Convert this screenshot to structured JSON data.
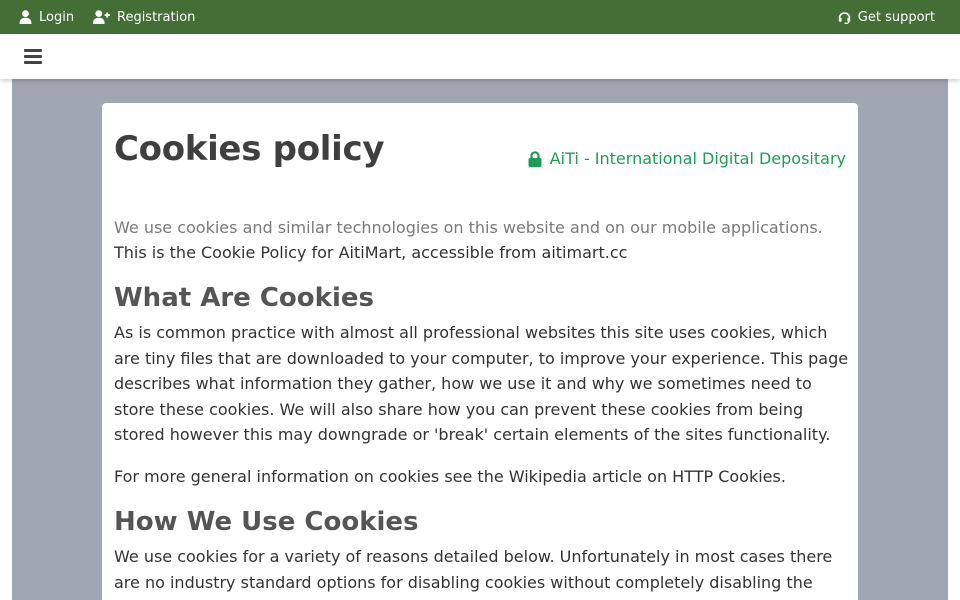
{
  "topbar": {
    "login_label": "Login",
    "registration_label": "Registration",
    "support_label": "Get support",
    "background_color": "#436f36"
  },
  "navbar": {
    "menu_icon": "hamburger-menu-icon"
  },
  "card": {
    "title": "Cookies policy",
    "brand_label": "AiTi - International Digital Depositary",
    "brand_color": "#1f9d56",
    "intro_line1": "We use cookies and similar technologies on this website and on our mobile applications.",
    "intro_line2": "This is the Cookie Policy for AitiMart, accessible from aitimart.cc",
    "sections": [
      {
        "heading": "What Are Cookies",
        "paragraphs": [
          "As is common practice with almost all professional websites this site uses cookies, which are tiny files that are downloaded to your computer, to improve your experience. This page describes what information they gather, how we use it and why we sometimes need to store these cookies. We will also share how you can prevent these cookies from being stored however this may downgrade or 'break' certain elements of the sites functionality.",
          "For more general information on cookies see the Wikipedia article on HTTP Cookies."
        ]
      },
      {
        "heading": "How We Use Cookies",
        "paragraphs": [
          "We use cookies for a variety of reasons detailed below. Unfortunately in most cases there are no industry standard options for disabling cookies without completely disabling the"
        ]
      }
    ]
  }
}
